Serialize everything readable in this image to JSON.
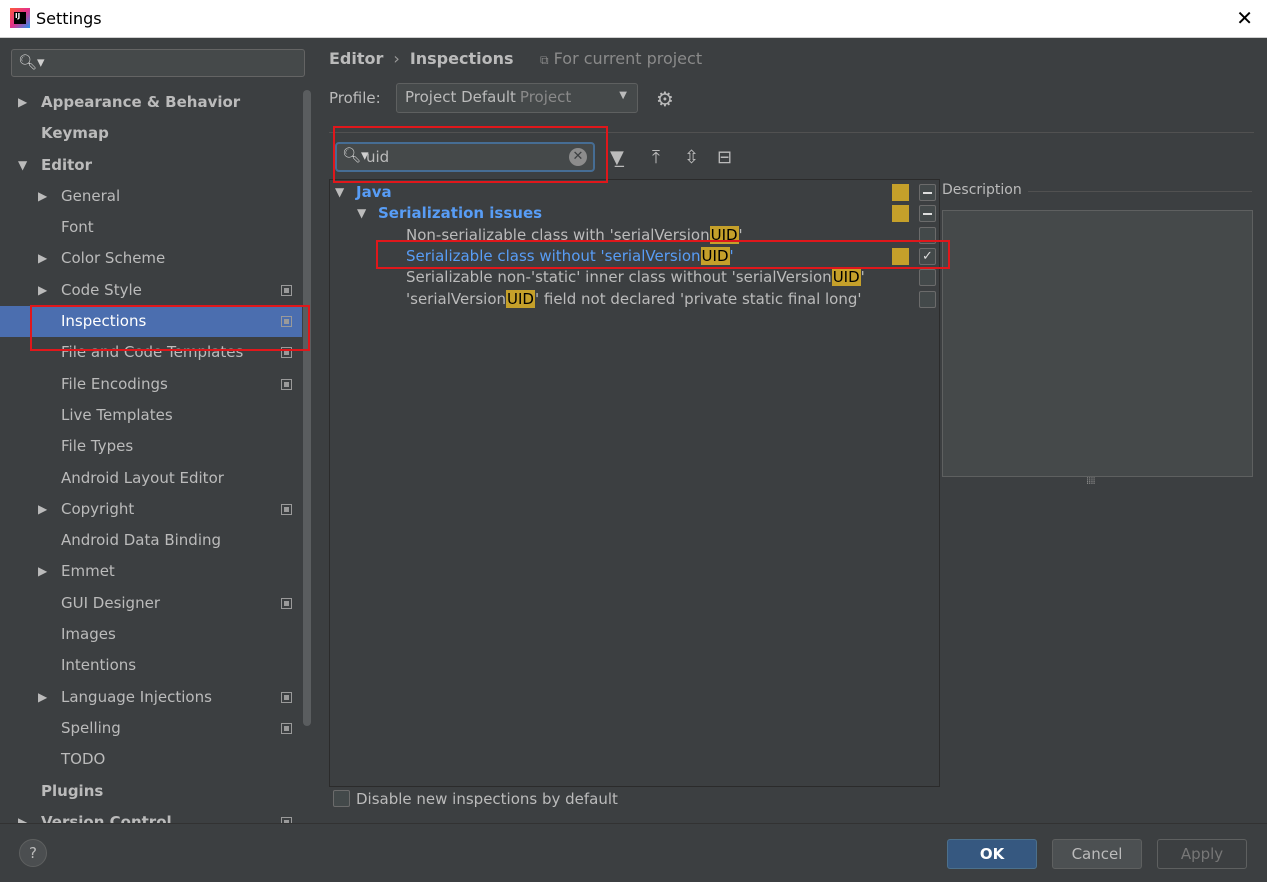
{
  "window": {
    "title": "Settings",
    "close_glyph": "✕"
  },
  "sidebar": {
    "search": {
      "value": ""
    },
    "items": [
      {
        "label": "Appearance & Behavior",
        "level": 0,
        "arrow": "▶",
        "bold": true,
        "project": false
      },
      {
        "label": "Keymap",
        "level": 0,
        "arrow": "",
        "bold": true,
        "project": false
      },
      {
        "label": "Editor",
        "level": 0,
        "arrow": "▼",
        "bold": true,
        "project": false
      },
      {
        "label": "General",
        "level": 1,
        "arrow": "▶",
        "bold": false,
        "project": false
      },
      {
        "label": "Font",
        "level": 1,
        "arrow": "",
        "bold": false,
        "project": false
      },
      {
        "label": "Color Scheme",
        "level": 1,
        "arrow": "▶",
        "bold": false,
        "project": false
      },
      {
        "label": "Code Style",
        "level": 1,
        "arrow": "▶",
        "bold": false,
        "project": true
      },
      {
        "label": "Inspections",
        "level": 1,
        "arrow": "",
        "bold": false,
        "project": true,
        "selected": true
      },
      {
        "label": "File and Code Templates",
        "level": 1,
        "arrow": "",
        "bold": false,
        "project": true
      },
      {
        "label": "File Encodings",
        "level": 1,
        "arrow": "",
        "bold": false,
        "project": true
      },
      {
        "label": "Live Templates",
        "level": 1,
        "arrow": "",
        "bold": false,
        "project": false
      },
      {
        "label": "File Types",
        "level": 1,
        "arrow": "",
        "bold": false,
        "project": false
      },
      {
        "label": "Android Layout Editor",
        "level": 1,
        "arrow": "",
        "bold": false,
        "project": false
      },
      {
        "label": "Copyright",
        "level": 1,
        "arrow": "▶",
        "bold": false,
        "project": true
      },
      {
        "label": "Android Data Binding",
        "level": 1,
        "arrow": "",
        "bold": false,
        "project": false
      },
      {
        "label": "Emmet",
        "level": 1,
        "arrow": "▶",
        "bold": false,
        "project": false
      },
      {
        "label": "GUI Designer",
        "level": 1,
        "arrow": "",
        "bold": false,
        "project": true
      },
      {
        "label": "Images",
        "level": 1,
        "arrow": "",
        "bold": false,
        "project": false
      },
      {
        "label": "Intentions",
        "level": 1,
        "arrow": "",
        "bold": false,
        "project": false
      },
      {
        "label": "Language Injections",
        "level": 1,
        "arrow": "▶",
        "bold": false,
        "project": true
      },
      {
        "label": "Spelling",
        "level": 1,
        "arrow": "",
        "bold": false,
        "project": true
      },
      {
        "label": "TODO",
        "level": 1,
        "arrow": "",
        "bold": false,
        "project": false
      },
      {
        "label": "Plugins",
        "level": 0,
        "arrow": "",
        "bold": true,
        "project": false
      },
      {
        "label": "Version Control",
        "level": 0,
        "arrow": "▶",
        "bold": true,
        "project": true
      }
    ]
  },
  "main": {
    "breadcrumb": {
      "parent": "Editor",
      "separator": "›",
      "current": "Inspections"
    },
    "for_current_project": "For current project",
    "profile": {
      "label": "Profile:",
      "name": "Project Default",
      "scope": "Project"
    },
    "search": {
      "value": "uid"
    },
    "tree": [
      {
        "kind": "group",
        "level": 0,
        "arrow": "▼",
        "text": "Java",
        "severity": true,
        "check": "mixed"
      },
      {
        "kind": "group",
        "level": 1,
        "arrow": "▼",
        "text": "Serialization issues",
        "severity": true,
        "check": "mixed"
      },
      {
        "kind": "item",
        "level": 2,
        "pre": "Non-serializable class with 'serialVersion",
        "match": "UID",
        "post": "'",
        "severity": false,
        "check": "off",
        "selected": false
      },
      {
        "kind": "item",
        "level": 2,
        "pre": "Serializable class without 'serialVersion",
        "match": "UID",
        "post": "'",
        "severity": true,
        "check": "on",
        "selected": true
      },
      {
        "kind": "item",
        "level": 2,
        "pre": "Serializable non-'static' inner class without 'serialVersion",
        "match": "UID",
        "post": "'",
        "severity": false,
        "check": "off",
        "selected": false
      },
      {
        "kind": "item",
        "level": 2,
        "pre": "'serialVersion",
        "match": "UID",
        "post": "' field not declared 'private static final long'",
        "severity": false,
        "check": "off",
        "selected": false
      }
    ],
    "description_label": "Description",
    "disable_new_label": "Disable new inspections by default"
  },
  "footer": {
    "help": "?",
    "ok": "OK",
    "cancel": "Cancel",
    "apply": "Apply"
  },
  "colors": {
    "accent_selection": "#4b6eaf",
    "link_blue": "#589df6",
    "severity_warning": "#c5a02a",
    "annotation_red": "#e0171b"
  }
}
